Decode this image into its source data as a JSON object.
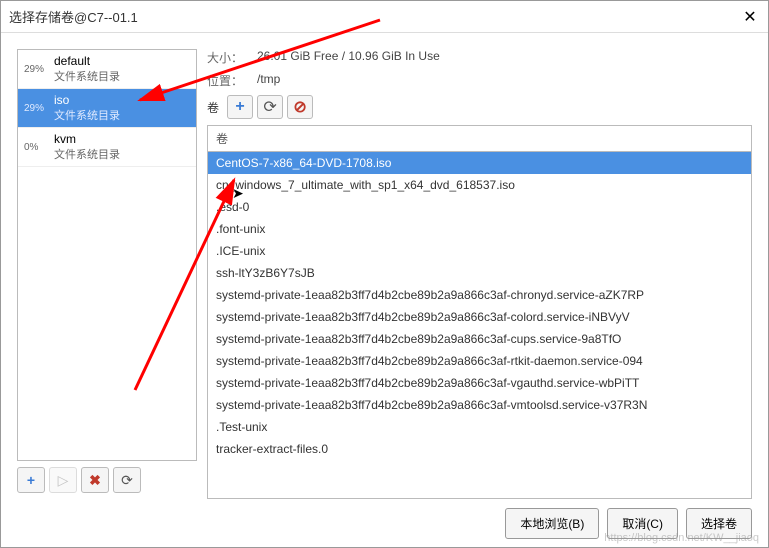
{
  "titlebar": {
    "title": "选择存储卷@C7--01.1"
  },
  "pools": [
    {
      "pct": "29%",
      "name": "default",
      "type": "文件系统目录",
      "selected": false
    },
    {
      "pct": "29%",
      "name": "iso",
      "type": "文件系统目录",
      "selected": true
    },
    {
      "pct": "0%",
      "name": "kvm",
      "type": "文件系统目录",
      "selected": false
    }
  ],
  "info": {
    "size_label": "大小：",
    "size_value": "26.01 GiB Free / 10.96 GiB In Use",
    "loc_label": "位置：",
    "loc_value": "/tmp"
  },
  "vol_toolbar_label": "卷",
  "vol_header": "卷",
  "volumes": [
    {
      "name": "CentOS-7-x86_64-DVD-1708.iso",
      "selected": true
    },
    {
      "name": "cn_windows_7_ultimate_with_sp1_x64_dvd_618537.iso",
      "selected": false
    },
    {
      "name": ".esd-0",
      "selected": false
    },
    {
      "name": ".font-unix",
      "selected": false
    },
    {
      "name": ".ICE-unix",
      "selected": false
    },
    {
      "name": "ssh-ltY3zB6Y7sJB",
      "selected": false
    },
    {
      "name": "systemd-private-1eaa82b3ff7d4b2cbe89b2a9a866c3af-chronyd.service-aZK7RP",
      "selected": false
    },
    {
      "name": "systemd-private-1eaa82b3ff7d4b2cbe89b2a9a866c3af-colord.service-iNBVyV",
      "selected": false
    },
    {
      "name": "systemd-private-1eaa82b3ff7d4b2cbe89b2a9a866c3af-cups.service-9a8TfO",
      "selected": false
    },
    {
      "name": "systemd-private-1eaa82b3ff7d4b2cbe89b2a9a866c3af-rtkit-daemon.service-094",
      "selected": false
    },
    {
      "name": "systemd-private-1eaa82b3ff7d4b2cbe89b2a9a866c3af-vgauthd.service-wbPiTT",
      "selected": false
    },
    {
      "name": "systemd-private-1eaa82b3ff7d4b2cbe89b2a9a866c3af-vmtoolsd.service-v37R3N",
      "selected": false
    },
    {
      "name": ".Test-unix",
      "selected": false
    },
    {
      "name": "tracker-extract-files.0",
      "selected": false
    }
  ],
  "footer": {
    "browse": "本地浏览(B)",
    "cancel": "取消(C)",
    "choose": "选择卷"
  },
  "icons": {
    "plus": "+",
    "play": "▷",
    "delete": "✖",
    "refresh": "⟳"
  },
  "watermark": "https://blog.csdn.net/KW__jiaoq"
}
